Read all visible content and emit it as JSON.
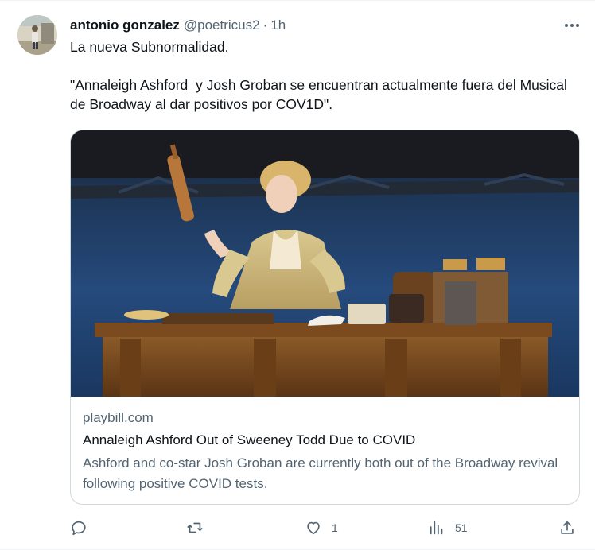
{
  "tweet": {
    "author_name": "antonio gonzalez",
    "author_handle": "@poetricus2",
    "separator": "·",
    "time": "1h",
    "text_lines": [
      "La nueva Subnormalidad.",
      "\"Annaleigh Ashford  y Josh Groban se encuentran actualmente fuera del Musical de Broadway al dar positivos por COV1D\"."
    ]
  },
  "card": {
    "domain": "playbill.com",
    "title": "Annaleigh Ashford Out of Sweeney Todd Due to COVID",
    "description": "Ashford and co-star Josh Groban are currently both out of the Broadway revival following positive COVID tests."
  },
  "actions": {
    "reply_count": "",
    "retweet_count": "",
    "like_count": "1",
    "views_count": "51"
  },
  "icons": {
    "more": "more-horizontal-icon",
    "reply": "reply-icon",
    "retweet": "retweet-icon",
    "like": "heart-icon",
    "views": "views-chart-icon",
    "share": "share-icon"
  },
  "colors": {
    "text_primary": "#0f1419",
    "text_secondary": "#536471",
    "border": "#cfd9de"
  }
}
